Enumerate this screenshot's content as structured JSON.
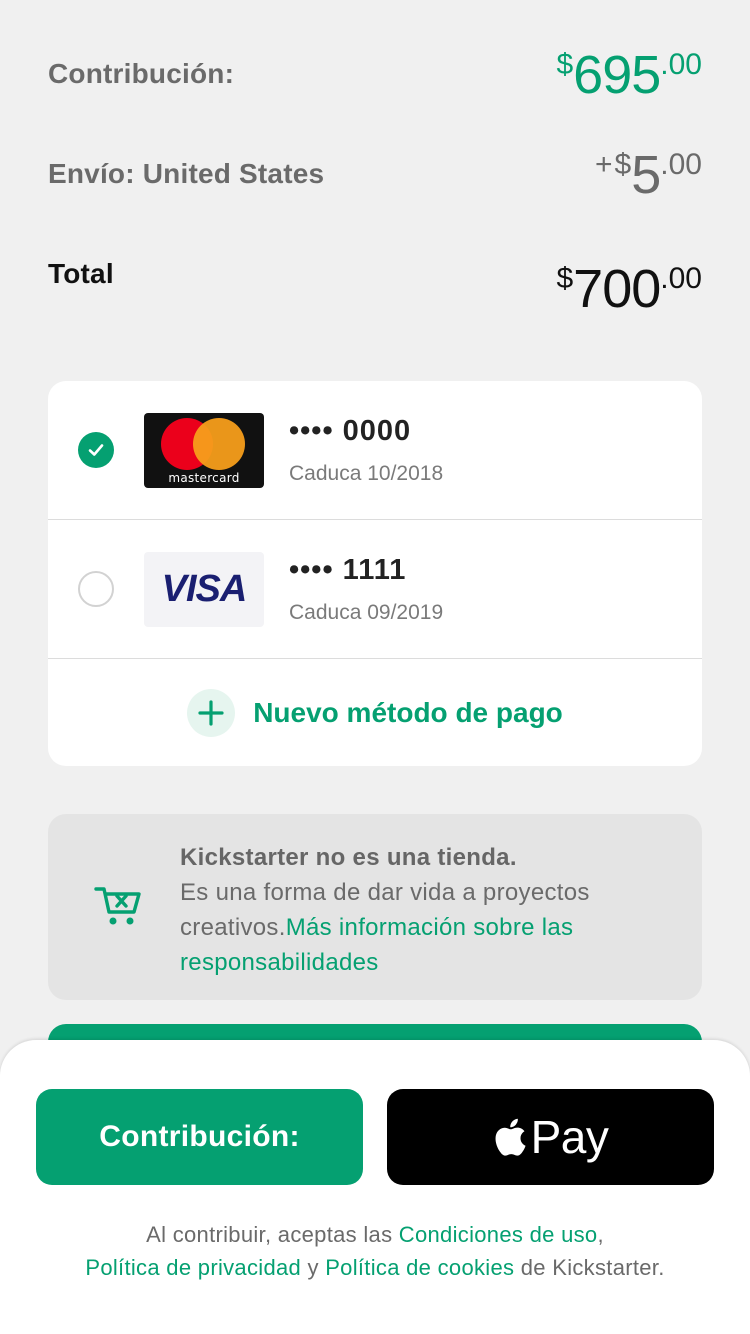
{
  "summary": {
    "contribution": {
      "label": "Contribución:",
      "currency": "$",
      "whole": "695",
      "cents": ".00"
    },
    "shipping": {
      "label": "Envío: United States",
      "prefix": "+",
      "currency": "$",
      "whole": "5",
      "cents": ".00"
    },
    "total": {
      "label": "Total",
      "currency": "$",
      "whole": "700",
      "cents": ".00"
    }
  },
  "payment_methods": [
    {
      "brand": "mastercard",
      "brand_text": "mastercard",
      "number": "•••• 0000",
      "expiry": "Caduca 10/2018",
      "selected": true
    },
    {
      "brand": "visa",
      "brand_text": "VISA",
      "number": "•••• 1111",
      "expiry": "Caduca 09/2019",
      "selected": false
    }
  ],
  "new_payment_method": {
    "label": "Nuevo método de pago",
    "icon": "plus-icon"
  },
  "info": {
    "icon": "cart-x-icon",
    "heading": "Kickstarter no es una tienda.",
    "body": "Es una forma de dar vida a proyectos creativos.",
    "link": "Más información sobre las responsabilidades"
  },
  "actions": {
    "contribute_label": "Contribución:",
    "apple_pay_label": "Pay",
    "apple_icon": "apple-logo-icon"
  },
  "terms": {
    "prefix": "Al contribuir, aceptas las ",
    "terms_link": "Condiciones de uso",
    "comma": ",",
    "privacy_link": "Política de privacidad",
    "and": " y ",
    "cookies_link": "Política de cookies",
    "suffix": " de Kickstarter."
  },
  "colors": {
    "accent": "#05a071",
    "background": "#f0f0f0",
    "text_muted": "#6a6a6a"
  }
}
